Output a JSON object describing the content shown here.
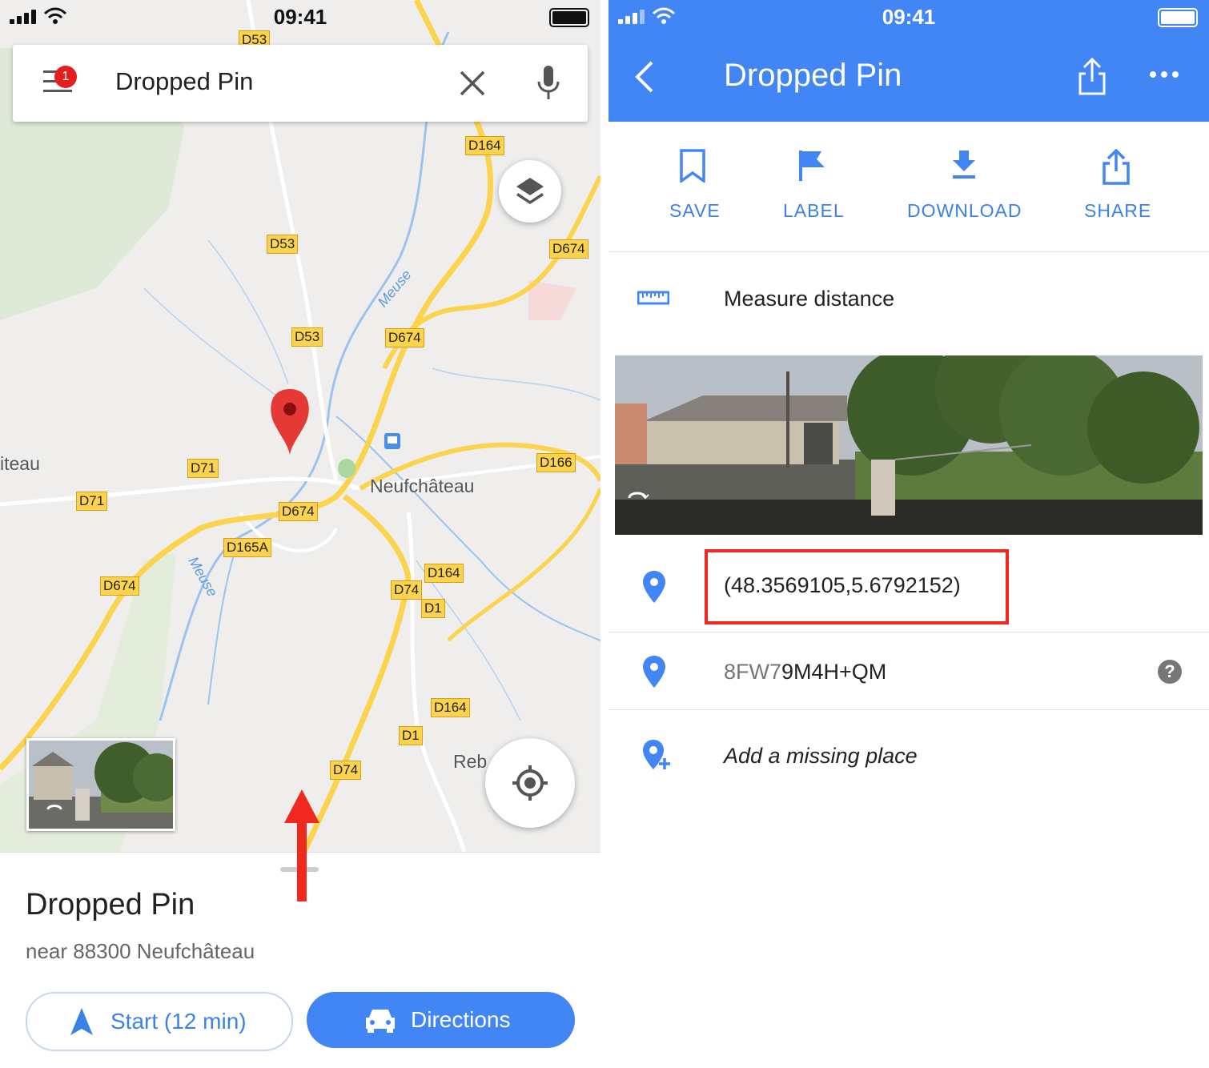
{
  "status_bar": {
    "time": "09:41"
  },
  "left": {
    "search": {
      "value": "Dropped Pin",
      "menu_badge": "1"
    },
    "map": {
      "roads": [
        "D53",
        "D164",
        "D53",
        "D674",
        "D53",
        "D674",
        "D71",
        "D166",
        "D71",
        "D674",
        "D165A",
        "D164",
        "D674",
        "D74",
        "D1",
        "D164",
        "D1",
        "D74"
      ],
      "places": {
        "neufchateau": "Neufchâteau",
        "left_edge": "iteau",
        "reb": "Reb"
      },
      "rivers": [
        "Meuse",
        "Meuse"
      ]
    },
    "sheet": {
      "title": "Dropped Pin",
      "subtitle": "near 88300 Neufchâteau",
      "start_label": "Start (12 min)",
      "directions_label": "Directions"
    }
  },
  "right": {
    "header": {
      "title": "Dropped Pin"
    },
    "actions": [
      {
        "label": "SAVE",
        "icon": "bookmark-icon"
      },
      {
        "label": "LABEL",
        "icon": "flag-icon"
      },
      {
        "label": "DOWNLOAD",
        "icon": "download-icon"
      },
      {
        "label": "SHARE",
        "icon": "share-icon"
      }
    ],
    "measure_label": "Measure distance",
    "coordinates": "(48.3569105,5.6792152)",
    "plus_code_prefix": "8FW7",
    "plus_code_main": "9M4H+QM",
    "add_place_label": "Add a missing place",
    "help_glyph": "?"
  },
  "colors": {
    "accent": "#4285f4",
    "pin_red": "#e53935",
    "highlight_red": "#f0281e",
    "road_yellow": "#fcd34d"
  }
}
